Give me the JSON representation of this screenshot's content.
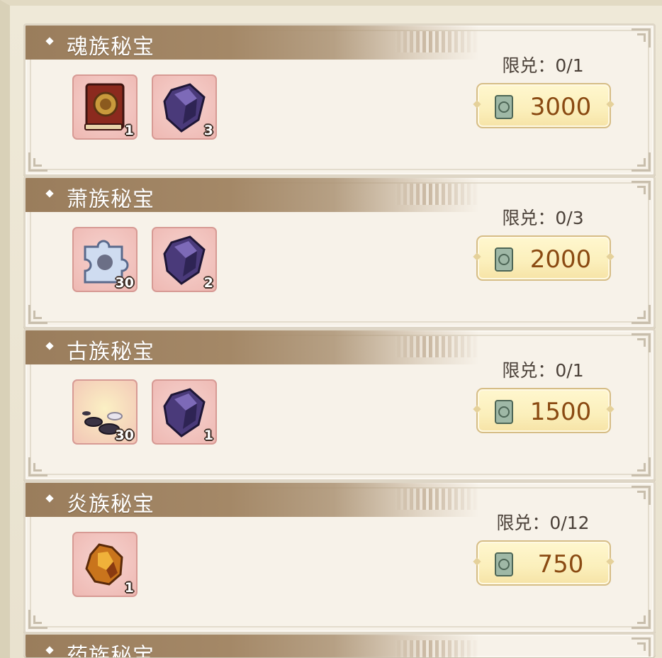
{
  "colors": {
    "banner": "#9a7d5c",
    "panel": "#f7f2e9",
    "item_bg": "#f2c2bd",
    "button_bg": "#fbefbb",
    "price_text": "#8a4a12"
  },
  "limit_label": "限兑：",
  "packs": [
    {
      "title": "魂族秘宝",
      "limit": "限兑：0/1",
      "price": "3000",
      "price_icon": "jade-token-icon",
      "items": [
        {
          "icon": "red-book-icon",
          "count": "1"
        },
        {
          "icon": "purple-crystal-icon",
          "count": "3"
        }
      ]
    },
    {
      "title": "萧族秘宝",
      "limit": "限兑：0/3",
      "price": "2000",
      "price_icon": "jade-token-icon",
      "items": [
        {
          "icon": "blue-puzzle-piece-icon",
          "count": "30"
        },
        {
          "icon": "purple-crystal-icon",
          "count": "2"
        }
      ]
    },
    {
      "title": "古族秘宝",
      "limit": "限兑：0/1",
      "price": "1500",
      "price_icon": "jade-token-icon",
      "items": [
        {
          "icon": "black-pills-icon",
          "count": "30"
        },
        {
          "icon": "purple-crystal-icon",
          "count": "1"
        }
      ]
    },
    {
      "title": "炎族秘宝",
      "limit": "限兑：0/12",
      "price": "750",
      "price_icon": "jade-token-icon",
      "items": [
        {
          "icon": "fire-ore-icon",
          "count": "1"
        }
      ]
    },
    {
      "title": "药族秘宝",
      "partial": true
    }
  ]
}
